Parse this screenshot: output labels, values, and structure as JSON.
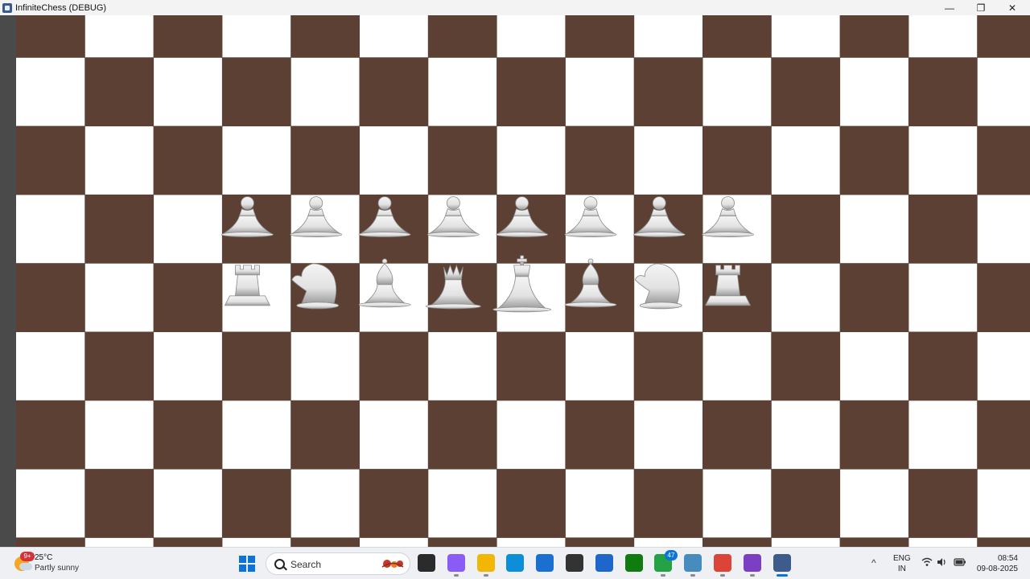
{
  "window": {
    "title": "InfiniteChess (DEBUG)",
    "controls": {
      "minimize": "—",
      "maximize": "❐",
      "close": "✕"
    }
  },
  "board": {
    "dark_color": "#5c4033",
    "light_color": "#ffffff",
    "piece_color": "#e2e2e2",
    "rows": [
      {
        "rank": 1,
        "pieces": [
          "pawn",
          "pawn",
          "pawn",
          "pawn",
          "pawn",
          "pawn",
          "pawn",
          "pawn"
        ]
      },
      {
        "rank": 0,
        "pieces": [
          "rook",
          "knight",
          "bishop",
          "queen",
          "king",
          "bishop",
          "knight",
          "rook"
        ]
      }
    ]
  },
  "taskbar": {
    "weather": {
      "temp": "25°C",
      "condition": "Partly sunny",
      "badge": "9+"
    },
    "search_placeholder": "Search",
    "apps": [
      {
        "name": "file-manager-icon",
        "color": "#2b2b2b",
        "badge": ""
      },
      {
        "name": "copilot-icon",
        "color": "#8a5cf5",
        "badge": ""
      },
      {
        "name": "file-explorer-icon",
        "color": "#f2b705",
        "badge": ""
      },
      {
        "name": "edge-icon",
        "color": "#0c8fd8",
        "badge": ""
      },
      {
        "name": "microsoft-store-icon",
        "color": "#1b6fd1",
        "badge": ""
      },
      {
        "name": "unity-icon",
        "color": "#333333",
        "badge": ""
      },
      {
        "name": "vs-code-icon",
        "color": "#1e66c9",
        "badge": ""
      },
      {
        "name": "xbox-icon",
        "color": "#107c10",
        "badge": ""
      },
      {
        "name": "whatsapp-icon",
        "color": "#25a244",
        "badge": "47"
      },
      {
        "name": "godot-icon",
        "color": "#478cbf",
        "badge": ""
      },
      {
        "name": "chrome-icon",
        "color": "#db4437",
        "badge": ""
      },
      {
        "name": "clipchamp-icon",
        "color": "#7b3fc4",
        "badge": ""
      },
      {
        "name": "godot-active-icon",
        "color": "#3d5c8c",
        "badge": ""
      }
    ],
    "tray": {
      "chevron": "^",
      "lang_line1": "ENG",
      "lang_line2": "IN",
      "time": "08:54",
      "date": "09-08-2025"
    }
  }
}
